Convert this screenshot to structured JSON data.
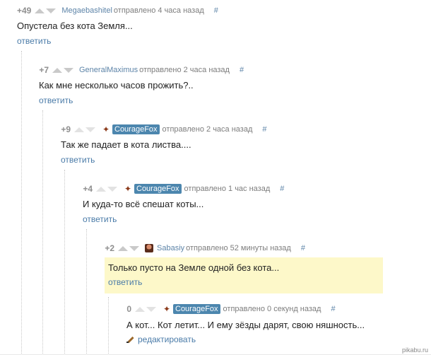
{
  "comments": [
    {
      "rating": "+49",
      "author": "Megaebashitel",
      "sent": "отправлено 4 часа назад",
      "hash": "#",
      "text": "Опустела без кота Земля...",
      "action": "ответить"
    },
    {
      "rating": "+7",
      "author": "GeneralMaximus",
      "sent": "отправлено 2 часа назад",
      "hash": "#",
      "text": "Как мне несколько часов прожить?..",
      "action": "ответить"
    },
    {
      "rating": "+9",
      "author": "CourageFox",
      "sent": "отправлено 2 часа назад",
      "hash": "#",
      "text": "Так же падает в кота листва....",
      "action": "ответить"
    },
    {
      "rating": "+4",
      "author": "CourageFox",
      "sent": "отправлено 1 час назад",
      "hash": "#",
      "text": "И куда-то всё спешат коты...",
      "action": "ответить"
    },
    {
      "rating": "+2",
      "author": "Sabasiy",
      "sent": "отправлено 52 минуты назад",
      "hash": "#",
      "text": "Только пусто на Земле одной без кота...",
      "action": "ответить"
    },
    {
      "rating": "0",
      "author": "CourageFox",
      "sent": "отправлено 0 секунд назад",
      "hash": "#",
      "text": "А кот... Кот летит... И ему зёзды дарят, свою няшность...",
      "action": "редактировать"
    }
  ],
  "icons": {
    "vote_up": "triangle-up-icon",
    "vote_down": "triangle-down-icon",
    "couragefox_badge": "fox-icon",
    "sabasiy_avatar": "avatar-icon",
    "edit": "pencil-icon"
  },
  "colors": {
    "link": "#4a7ba8",
    "author_tag_bg": "#4c86ae",
    "highlight_bg": "#fdf8c9",
    "rating": "#8e8e8e"
  },
  "watermark": "pikabu.ru"
}
